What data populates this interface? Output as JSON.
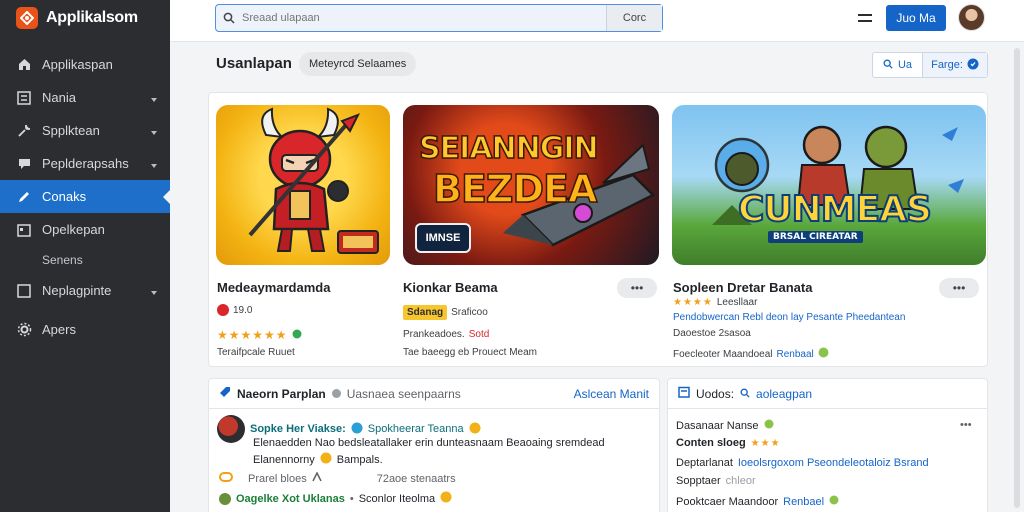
{
  "app": {
    "title": "Applikalsom",
    "accent": "#1e6fc9",
    "brand_color": "#e8531a"
  },
  "sidebar": {
    "items": [
      {
        "label": "Applikaspan",
        "icon": "home-icon"
      },
      {
        "label": "Nania",
        "icon": "list-icon"
      },
      {
        "label": "Spplktean",
        "icon": "tool-icon"
      },
      {
        "label": "Peplderapsahs",
        "icon": "chat-icon"
      },
      {
        "label": "Conaks",
        "icon": "pen-icon",
        "active": true
      },
      {
        "label": "Opelkepan",
        "icon": "calendar-icon"
      },
      {
        "label": "Senens",
        "sub": true
      },
      {
        "label": "Neplagpinte",
        "icon": "box-icon"
      },
      {
        "label": "Apers",
        "icon": "gear-icon"
      }
    ]
  },
  "topbar": {
    "search_placeholder": "Sreaad ulapaan",
    "search_button": "Corc",
    "login_button": "Juo Ma"
  },
  "section": {
    "title": "Usanlapan",
    "chip": "Meteyrcd Selaames",
    "seg_a": "Ua",
    "seg_b": "Farge:"
  },
  "cards": [
    {
      "title": "Medeaymardamda",
      "meta1": "19.0",
      "stars": "★★★★★★",
      "meta2": "Teraifpcale Ruuet",
      "more": "•••"
    },
    {
      "title": "Kionkar Beama",
      "art_line1": "SEIANNGIN",
      "art_line2": "BEZDEA",
      "art_badge": "IMNSE",
      "badge": "Sdanag",
      "meta1_b": "Sraficoo",
      "meta2_a": "Prankeadoes.",
      "meta2_b": "Sotd",
      "meta3": "Tae baeegg eb Prouect Meam",
      "more": "•••"
    },
    {
      "title": "Sopleen Dretar Banata",
      "art_line1": "CUNMEAS",
      "art_line2": "BRSAL CIREATAR",
      "stars": "★★★★",
      "meta1": "Leesllaar",
      "meta2": "Pendobwercan Rebl deon lay Pesante Pheedantean",
      "meta3": "Daoestoe 2sasoa",
      "meta4_a": "Foecleoter Maandoeal",
      "meta4_b": "Renbaal",
      "more": "•••"
    }
  ],
  "panel_left": {
    "title": "Naeorn Parplan",
    "subtitle": "Uasnaea seenpaarns",
    "link": "Aslcean Manit",
    "row1_a": "Sopke Her Viakse:",
    "row1_b": "Spokheerar Teanna",
    "row2": "Elenaedden Nao bedsleatallaker erin dunteasnaam Beaoaing sremdead",
    "row3_a": "Elanennorny",
    "row3_b": "Bampals.",
    "row4_a": "Prarel bloes",
    "row4_b": "72aoe stenaatrs",
    "row5_a": "Oagelke Xot Uklanas",
    "row5_b": "Sconlor Iteolma"
  },
  "panel_right": {
    "title": "Uodos:",
    "link": "aoleagpan",
    "row1": "Dasanaar Nanse",
    "row2_a": "Conten sloeg",
    "row2_b": "★★★",
    "row3_a": "Deptarlanat",
    "row3_b": "Ioeolsrgoxom Pseondeleotaloiz Bsrand",
    "row4_a": "Sopptaer",
    "row4_b": "chleor",
    "row5_a": "Pooktcaer Maandoor",
    "row5_b": "Renbael"
  }
}
